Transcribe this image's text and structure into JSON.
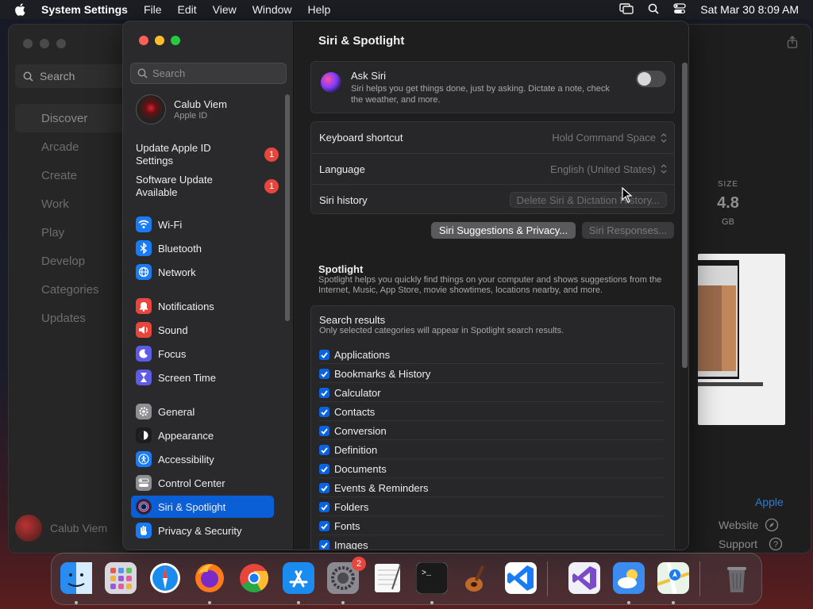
{
  "menubar": {
    "app_name": "System Settings",
    "items": [
      "File",
      "Edit",
      "View",
      "Window",
      "Help"
    ],
    "datetime": "Sat Mar 30  8:09 AM"
  },
  "appstore": {
    "search_placeholder": "Search",
    "nav": [
      "Discover",
      "Arcade",
      "Create",
      "Work",
      "Play",
      "Develop",
      "Categories",
      "Updates"
    ],
    "active_nav": "Discover",
    "user_name": "Calub Viem",
    "size_label": "SIZE",
    "size_value": "4.8",
    "size_unit": "GB",
    "developer_link": "Apple",
    "website_label": "Website",
    "support_label": "Support"
  },
  "settings": {
    "search_placeholder": "Search",
    "user": {
      "name": "Calub Viem",
      "subtitle": "Apple ID"
    },
    "notices": [
      {
        "label": "Update Apple ID Settings",
        "badge": "1"
      },
      {
        "label": "Software Update Available",
        "badge": "1"
      }
    ],
    "sidebar": [
      {
        "label": "Wi-Fi",
        "icon": "wifi-icon",
        "color": "#1a7cf5"
      },
      {
        "label": "Bluetooth",
        "icon": "bluetooth-icon",
        "color": "#1a7cf5"
      },
      {
        "label": "Network",
        "icon": "globe-icon",
        "color": "#1a7cf5"
      },
      {
        "label": "Notifications",
        "icon": "bell-icon",
        "color": "#e8453c"
      },
      {
        "label": "Sound",
        "icon": "speaker-icon",
        "color": "#e8453c"
      },
      {
        "label": "Focus",
        "icon": "moon-icon",
        "color": "#5e5ce6"
      },
      {
        "label": "Screen Time",
        "icon": "hourglass-icon",
        "color": "#5e5ce6"
      },
      {
        "label": "General",
        "icon": "gear-icon",
        "color": "#8e8e93"
      },
      {
        "label": "Appearance",
        "icon": "appearance-icon",
        "color": "#1c1c1e"
      },
      {
        "label": "Accessibility",
        "icon": "accessibility-icon",
        "color": "#1a7cf5"
      },
      {
        "label": "Control Center",
        "icon": "control-center-icon",
        "color": "#8e8e93"
      },
      {
        "label": "Siri & Spotlight",
        "icon": "siri-icon",
        "color": "#2a2a40"
      },
      {
        "label": "Privacy & Security",
        "icon": "hand-icon",
        "color": "#1a7cf5"
      }
    ],
    "active_item": "Siri & Spotlight",
    "main": {
      "title": "Siri & Spotlight",
      "ask_siri": {
        "title": "Ask Siri",
        "description": "Siri helps you get things done, just by asking. Dictate a note, check the weather, and more.",
        "enabled": false
      },
      "keyboard_shortcut": {
        "label": "Keyboard shortcut",
        "value": "Hold Command Space"
      },
      "language": {
        "label": "Language",
        "value": "English (United States)"
      },
      "siri_history": {
        "label": "Siri history",
        "button": "Delete Siri & Dictation History..."
      },
      "suggestions_button": "Siri Suggestions & Privacy...",
      "responses_button": "Siri Responses...",
      "spotlight": {
        "title": "Spotlight",
        "description": "Spotlight helps you quickly find things on your computer and shows suggestions from the Internet, Music, App Store, movie showtimes, locations nearby, and more."
      },
      "search_results": {
        "title": "Search results",
        "description": "Only selected categories will appear in Spotlight search results.",
        "items": [
          "Applications",
          "Bookmarks & History",
          "Calculator",
          "Contacts",
          "Conversion",
          "Definition",
          "Documents",
          "Events & Reminders",
          "Folders",
          "Fonts",
          "Images"
        ]
      }
    }
  },
  "dock": {
    "apps": [
      {
        "name": "finder-icon",
        "color": "#2a8cf0"
      },
      {
        "name": "launchpad-icon",
        "color": "#d8d8de"
      },
      {
        "name": "safari-icon",
        "color": "#1a8cf0"
      },
      {
        "name": "firefox-icon",
        "color": "#ff7a1a"
      },
      {
        "name": "chrome-icon",
        "color": "#e8e8e8"
      },
      {
        "name": "app-store-icon",
        "color": "#1a8cf0"
      },
      {
        "name": "system-settings-icon",
        "color": "#7a7a80",
        "badge": "2"
      },
      {
        "name": "textedit-icon",
        "color": "#f0f0f0"
      },
      {
        "name": "terminal-icon",
        "color": "#1a1a1a"
      },
      {
        "name": "garageband-icon",
        "color": "#3a2a1a"
      },
      {
        "name": "vscode-icon",
        "color": "#1a7cf5"
      },
      {
        "name": "visual-studio-icon",
        "color": "#f0f0f8"
      },
      {
        "name": "weather-icon",
        "color": "#3a8cf0"
      },
      {
        "name": "maps-icon",
        "color": "#6ad07a"
      },
      {
        "name": "trash-icon",
        "color": "#6a6a6e"
      }
    ]
  }
}
